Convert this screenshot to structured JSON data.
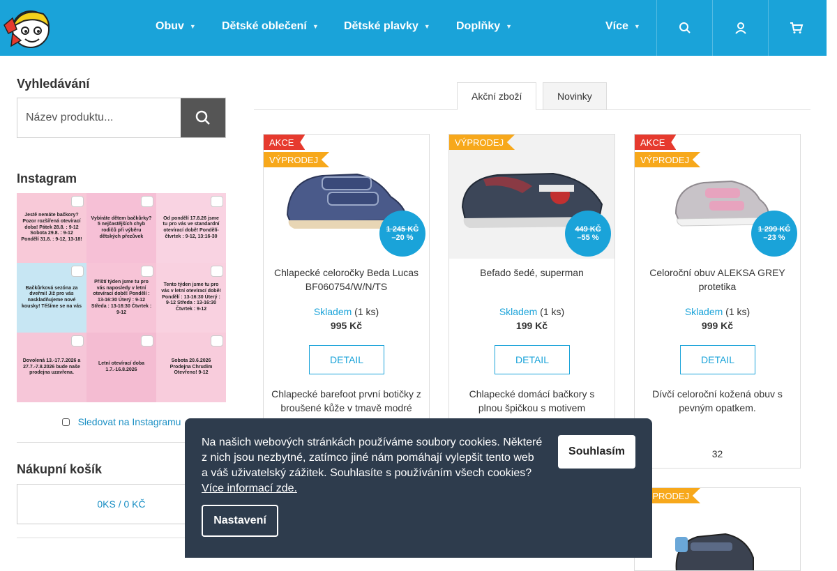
{
  "colors": {
    "brand": "#1aa3d9",
    "akce": "#e63a2e",
    "vyprodej": "#f7a81b",
    "cookie_bg": "#2e3c4d"
  },
  "header": {
    "nav": [
      {
        "label": "Obuv"
      },
      {
        "label": "Dětské oblečení"
      },
      {
        "label": "Dětské plavky"
      },
      {
        "label": "Doplňky"
      },
      {
        "label": "Více"
      }
    ],
    "icons": [
      "search-icon",
      "user-icon",
      "cart-icon"
    ]
  },
  "sidebar": {
    "search_title": "Vyhledávání",
    "search_placeholder": "Název produktu...",
    "instagram_title": "Instagram",
    "instagram_posts": [
      {
        "text": "Jestě nemáte bačkory? Pozor rozšířená otevírací doba! Pátek 28.8. : 9-12 Sobota 29.8. : 9-12 Pondělí 31.8. : 9-12, 13-18!"
      },
      {
        "text": "Vybíráte dětem bačkůrky? 5 nejčastějších chyb rodičů při výběru dětských přezůvek"
      },
      {
        "text": "Od pondělí 17.8.26 jsme tu pro vás ve standardní otevírací době! Pondělí-čtvrtek : 9-12, 13:16-30"
      },
      {
        "text": "Bačkůrková sezóna za dveřmi! Již pro vás naskladňujeme nové kousky! Těšíme se na vás"
      },
      {
        "text": "Příští týden jsme tu pro vás naposledy v letní otevírací době! Pondělí : 13-16:30 Úterý : 9-12 Středa : 13-16:30 Čtvrtek : 9-12"
      },
      {
        "text": "Tento týden jsme tu pro vás v letní otevírací době! Pondělí : 13-16:30 Úterý : 9-12 Středa : 13-16:30 Čtvrtek : 9-12"
      },
      {
        "text": "Dovolená 13.-17.7.2026 a 27.7.-7.8.2026 bude naše prodejna uzavřena."
      },
      {
        "text": "Letní otevírací doba 1.7.-16.8.2026"
      },
      {
        "text": "Sobota 20.6.2026 Prodejna Chrudim Otevřeno! 9-12"
      }
    ],
    "follow_label": "Sledovat na Instagramu",
    "cart_title": "Nákupní košík",
    "cart_summary": "0KS / 0 KČ"
  },
  "tabs": [
    {
      "label": "Akční zboží"
    },
    {
      "label": "Novinky"
    }
  ],
  "products": [
    {
      "flags": [
        "AKCE",
        "VÝPRODEJ"
      ],
      "old_price": "1 245 KČ",
      "discount": "–20 %",
      "name": "Chlapecké celoročky Beda Lucas BF060754/W/N/TS",
      "stock": "Skladem",
      "qty": "(1 ks)",
      "price": "995 Kč",
      "detail": "DETAIL",
      "desc": "Chlapecké barefoot první botičky z broušené kůže v tmavě modré",
      "size": ""
    },
    {
      "flags": [
        "VÝPRODEJ"
      ],
      "old_price": "449 KČ",
      "discount": "–55 %",
      "name": "Befado šedé, superman",
      "stock": "Skladem",
      "qty": "(1 ks)",
      "price": "199 Kč",
      "detail": "DETAIL",
      "desc": "Chlapecké domácí bačkory s plnou špičkou s motivem",
      "size": ""
    },
    {
      "flags": [
        "AKCE",
        "VÝPRODEJ"
      ],
      "old_price": "1 299 KČ",
      "discount": "–23 %",
      "name": "Celoroční obuv ALEKSA GREY protetika",
      "stock": "Skladem",
      "qty": "(1 ks)",
      "price": "999 Kč",
      "detail": "DETAIL",
      "desc": "Dívčí celoroční kožená obuv s pevným opatkem.",
      "size": "32"
    }
  ],
  "product4": {
    "flag": "VÝPRODEJ"
  },
  "cookie": {
    "text": "Na našich webových stránkách používáme soubory cookies. Některé z nich jsou nezbytné, zatímco jiné nám pomáhají vylepšit tento web a váš uživatelský zážitek. Souhlasíte s používáním všech cookies?",
    "link": "Více informací zde.",
    "accept": "Souhlasím",
    "settings": "Nastavení"
  }
}
